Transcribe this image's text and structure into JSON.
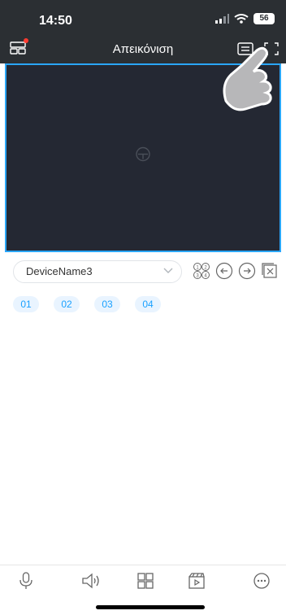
{
  "status": {
    "time": "14:50",
    "battery": "56"
  },
  "header": {
    "title": "Απεικόνιση"
  },
  "device": {
    "name": "DeviceName3"
  },
  "channels": [
    "01",
    "02",
    "03",
    "04"
  ],
  "bottom_bar": {
    "icons": [
      "microphone-icon",
      "speaker-icon",
      "grid-icon",
      "video-clip-icon",
      "more-icon"
    ]
  },
  "colors": {
    "accent": "#1aa1ff",
    "video_border": "#2aa6ff",
    "notification_dot": "#ff3b30"
  }
}
